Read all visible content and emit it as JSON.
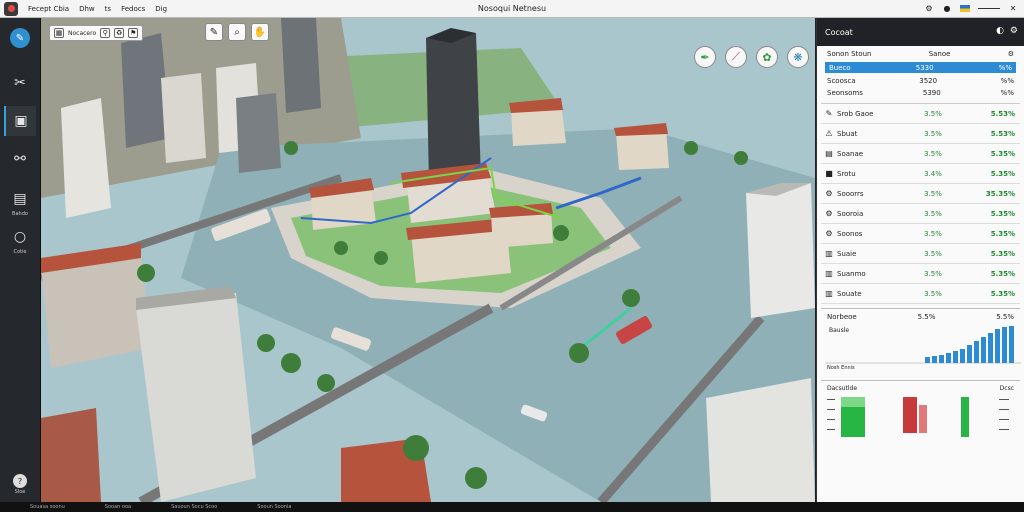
{
  "titlebar": {
    "menus": [
      "Fecept Cbia",
      "Dhw",
      "ts",
      "Fedocs",
      "Dig"
    ],
    "title": "Nosoqui Netnesu"
  },
  "left_tools": [
    {
      "icon": "brand-logo-icon",
      "label": ""
    },
    {
      "icon": "route-tool-icon",
      "label": ""
    },
    {
      "icon": "panel-tool-icon",
      "label": ""
    },
    {
      "icon": "connect-tool-icon",
      "label": ""
    },
    {
      "icon": "document-tool-icon",
      "label": "Bahdo"
    },
    {
      "icon": "bulb-tool-icon",
      "label": "Cotie"
    },
    {
      "icon": "help-tool-icon",
      "label": "Sloe"
    }
  ],
  "viewport_toolbar": {
    "label": "Nocacero"
  },
  "panel": {
    "title": "Cocoat",
    "col_left": "Sonon Stoun",
    "col_right": "Sanoe",
    "selected": {
      "name": "Bueco",
      "value": "5330",
      "unit": "%%"
    },
    "row2": {
      "name": "Scoosca",
      "value": "3520",
      "unit": "%%"
    },
    "row3": {
      "name": "Seonsoms",
      "value": "5390",
      "unit": "%%"
    },
    "rows": [
      {
        "icon": "pencil-icon",
        "name": "Srob Gaoe",
        "v1": "3.5%",
        "v2": "5.53%"
      },
      {
        "icon": "warning-icon",
        "name": "Sbuat",
        "v1": "3.5%",
        "v2": "5.53%"
      },
      {
        "icon": "layers-icon",
        "name": "Soanae",
        "v1": "3.5%",
        "v2": "5.35%"
      },
      {
        "icon": "truck-icon",
        "name": "Srotu",
        "v1": "3.4%",
        "v2": "5.35%"
      },
      {
        "icon": "gear-icon",
        "name": "Sooorrs",
        "v1": "3.5%",
        "v2": "35.35%"
      },
      {
        "icon": "gear-icon",
        "name": "Sooroia",
        "v1": "3.5%",
        "v2": "5.35%"
      },
      {
        "icon": "gear-icon",
        "name": "Soonos",
        "v1": "3.5%",
        "v2": "5.35%"
      },
      {
        "icon": "building-icon",
        "name": "Suaie",
        "v1": "3.5%",
        "v2": "5.35%"
      },
      {
        "icon": "building-icon",
        "name": "Suanmo",
        "v1": "3.5%",
        "v2": "5.35%"
      },
      {
        "icon": "building-icon",
        "name": "Souate",
        "v1": "3.5%",
        "v2": "5.35%"
      }
    ],
    "stats": {
      "title": "Norbeoe",
      "value": "5.5%",
      "value2": "5.5%",
      "subtitle": "Bausle",
      "footer": "Nosh Ennis"
    },
    "bars": {
      "left_title": "Dacsutlde",
      "right_title": "Dcsc"
    }
  },
  "status": {
    "items": [
      "Souasa soonu",
      "Sooan ooa",
      "Sauoun Socu Scoo",
      "Sooun Soonia"
    ]
  },
  "colors": {
    "accent": "#2d8bd6",
    "good": "#1b8a2f",
    "water": "#8fb0b7",
    "park": "#8bc27a",
    "roof": "#b5533c"
  }
}
